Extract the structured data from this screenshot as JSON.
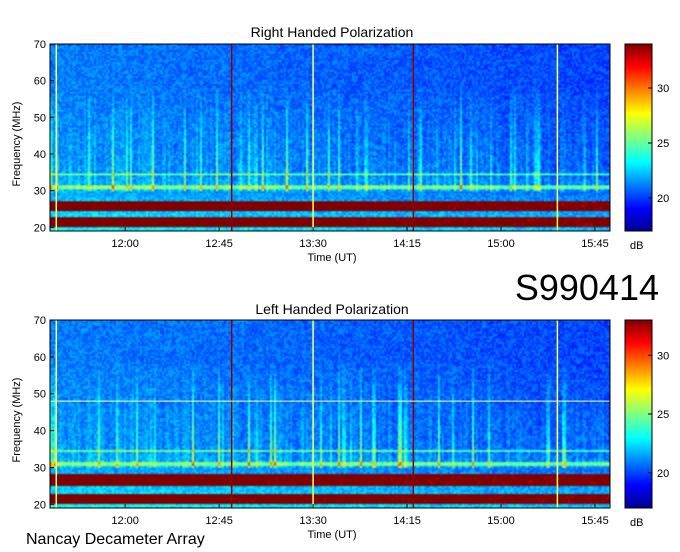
{
  "figure": {
    "id_label": "S990414",
    "footer": "Nancay Decameter Array"
  },
  "chart_data": [
    {
      "type": "heatmap",
      "title": "Right Handed Polarization",
      "xlabel": "Time (UT)",
      "ylabel": "Frequency (MHz)",
      "x_ticks": [
        "12:00",
        "12:45",
        "13:30",
        "14:15",
        "15:00",
        "15:45"
      ],
      "x_tick_hours": [
        12.0,
        12.75,
        13.5,
        14.25,
        15.0,
        15.75
      ],
      "xlim_hours": [
        11.4,
        15.87
      ],
      "y_ticks": [
        20,
        30,
        40,
        50,
        60,
        70
      ],
      "ylim": [
        19,
        70
      ],
      "colorbar": {
        "label": "dB",
        "ticks": [
          20,
          25,
          30
        ],
        "range": [
          17,
          34
        ]
      },
      "strong_bands_mhz": [
        [
          20,
          23
        ],
        [
          24.5,
          27
        ]
      ],
      "vertical_markers_hours": [
        11.45,
        12.85,
        13.5,
        14.3,
        15.45
      ],
      "horizontal_lines_mhz": []
    },
    {
      "type": "heatmap",
      "title": "Left Handed Polarization",
      "xlabel": "Time (UT)",
      "ylabel": "Frequency (MHz)",
      "x_ticks": [
        "12:00",
        "12:45",
        "13:30",
        "14:15",
        "15:00",
        "15:45"
      ],
      "x_tick_hours": [
        12.0,
        12.75,
        13.5,
        14.25,
        15.0,
        15.75
      ],
      "xlim_hours": [
        11.4,
        15.87
      ],
      "y_ticks": [
        20,
        30,
        40,
        50,
        60,
        70
      ],
      "ylim": [
        19,
        70
      ],
      "colorbar": {
        "label": "dB",
        "ticks": [
          20,
          25,
          30
        ],
        "range": [
          17,
          33
        ]
      },
      "strong_bands_mhz": [
        [
          20,
          23
        ],
        [
          25,
          28
        ]
      ],
      "vertical_markers_hours": [
        11.45,
        12.85,
        13.5,
        14.3,
        15.45
      ],
      "horizontal_lines_mhz": [
        48
      ]
    }
  ]
}
